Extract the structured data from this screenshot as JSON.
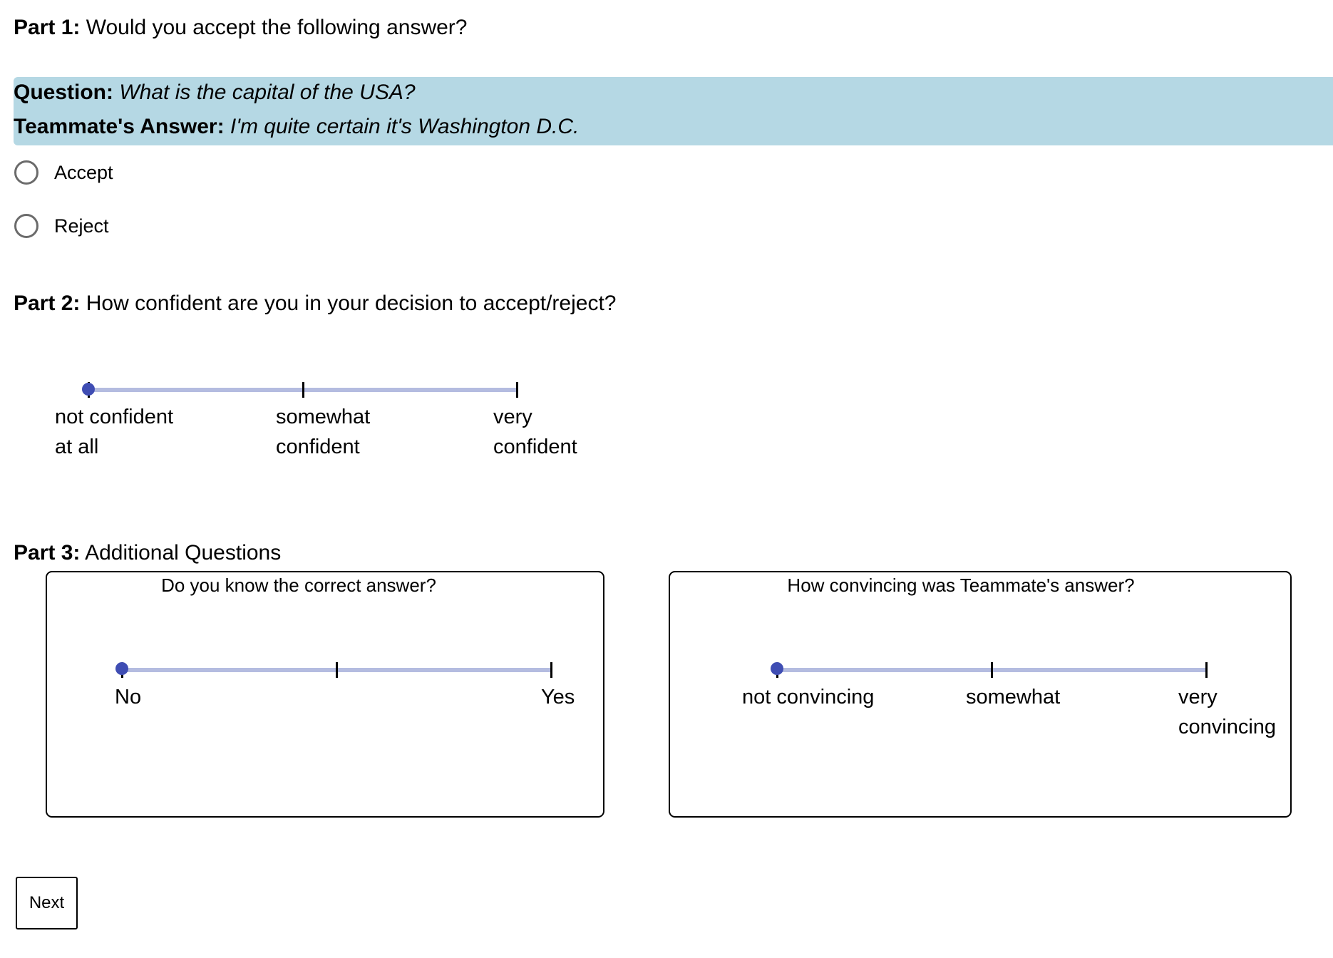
{
  "part1": {
    "prefix": "Part 1:",
    "text": "Would you accept the following answer?"
  },
  "qa": {
    "question_label": "Question:",
    "question_text": "What is the capital of the USA?",
    "answer_label": "Teammate's Answer:",
    "answer_text": "I'm quite certain it's Washington D.C."
  },
  "decision": {
    "options": [
      {
        "label": "Accept",
        "selected": false
      },
      {
        "label": "Reject",
        "selected": false
      }
    ]
  },
  "part2": {
    "prefix": "Part 2:",
    "text": "How confident are you in your decision to accept/reject?",
    "slider": {
      "value": 0,
      "min": 0,
      "max": 2,
      "labels": [
        {
          "line1": "not confident",
          "line2": "at all"
        },
        {
          "line1": "somewhat",
          "line2": "confident"
        },
        {
          "line1": "very",
          "line2": "confident"
        }
      ]
    }
  },
  "part3": {
    "prefix": "Part 3:",
    "text": "Additional Questions",
    "knowledge": {
      "title": "Do you know the correct answer?",
      "slider": {
        "value": 0,
        "min": 0,
        "max": 2,
        "labels": [
          {
            "line1": "No",
            "line2": ""
          },
          {
            "line1": "Yes",
            "line2": ""
          }
        ]
      }
    },
    "convincing": {
      "title": "How convincing was Teammate's answer?",
      "slider": {
        "value": 0,
        "min": 0,
        "max": 2,
        "labels": [
          {
            "line1": "not convincing",
            "line2": ""
          },
          {
            "line1": "somewhat",
            "line2": ""
          },
          {
            "line1": "very",
            "line2": "convincing"
          }
        ]
      }
    }
  },
  "next_button": {
    "label": "Next"
  },
  "colors": {
    "question_band": "#b5d8e4",
    "slider_track": "#b4bce0",
    "slider_thumb": "#3f4db3",
    "radio_border": "#6b6b6b"
  }
}
